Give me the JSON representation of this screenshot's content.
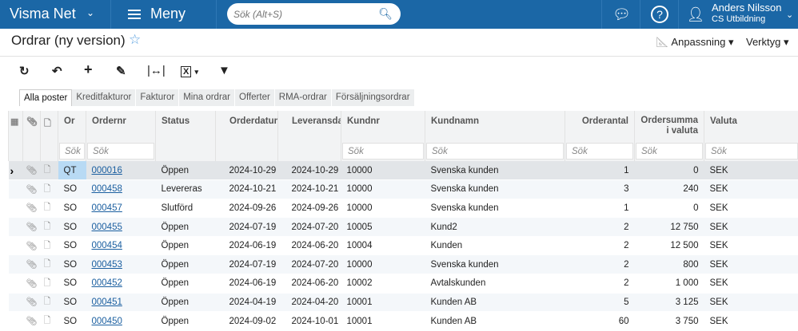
{
  "topbar": {
    "brand": "Visma Net",
    "menu": "Meny",
    "search_placeholder": "Sök (Alt+S)",
    "user_name": "Anders Nilsson",
    "user_company": "CS Utbildning"
  },
  "page": {
    "title": "Ordrar (ny version)",
    "customize": "Anpassning",
    "tools": "Verktyg"
  },
  "tabs": [
    "Alla poster",
    "Kreditfakturor",
    "Fakturor",
    "Mina ordrar",
    "Offerter",
    "RMA-ordrar",
    "Försäljningsordrar"
  ],
  "columns": {
    "type": "Or",
    "ordernr": "Ordernr",
    "status": "Status",
    "orderdate": "Orderdatum",
    "delivery": "Leveransda",
    "custnr": "Kundnr",
    "custname": "Kundnamn",
    "qty": "Orderantal",
    "sum": "Ordersumma i valuta",
    "currency": "Valuta"
  },
  "filter_placeholder": "Sök",
  "rows": [
    [
      "QT",
      "000016",
      "Öppen",
      "2024-10-29",
      "2024-10-29",
      "10000",
      "Svenska kunden",
      "1",
      "0",
      "SEK"
    ],
    [
      "SO",
      "000458",
      "Levereras",
      "2024-10-21",
      "2024-10-21",
      "10000",
      "Svenska kunden",
      "3",
      "240",
      "SEK"
    ],
    [
      "SO",
      "000457",
      "Slutförd",
      "2024-09-26",
      "2024-09-26",
      "10000",
      "Svenska kunden",
      "1",
      "0",
      "SEK"
    ],
    [
      "SO",
      "000455",
      "Öppen",
      "2024-07-19",
      "2024-07-20",
      "10005",
      "Kund2",
      "2",
      "12 750",
      "SEK"
    ],
    [
      "SO",
      "000454",
      "Öppen",
      "2024-06-19",
      "2024-06-20",
      "10004",
      "Kunden",
      "2",
      "12 500",
      "SEK"
    ],
    [
      "SO",
      "000453",
      "Öppen",
      "2024-07-19",
      "2024-07-20",
      "10000",
      "Svenska kunden",
      "2",
      "800",
      "SEK"
    ],
    [
      "SO",
      "000452",
      "Öppen",
      "2024-06-19",
      "2024-06-20",
      "10002",
      "Avtalskunden",
      "2",
      "1 000",
      "SEK"
    ],
    [
      "SO",
      "000451",
      "Öppen",
      "2024-04-19",
      "2024-04-20",
      "10001",
      "Kunden AB",
      "5",
      "3 125",
      "SEK"
    ],
    [
      "SO",
      "000450",
      "Öppen",
      "2024-09-02",
      "2024-10-01",
      "10001",
      "Kunden AB",
      "60",
      "3 750",
      "SEK"
    ]
  ],
  "colors": {
    "topbar": "#1b67a6",
    "selected_cell": "#b8daf4",
    "link": "#1b5fa0"
  }
}
